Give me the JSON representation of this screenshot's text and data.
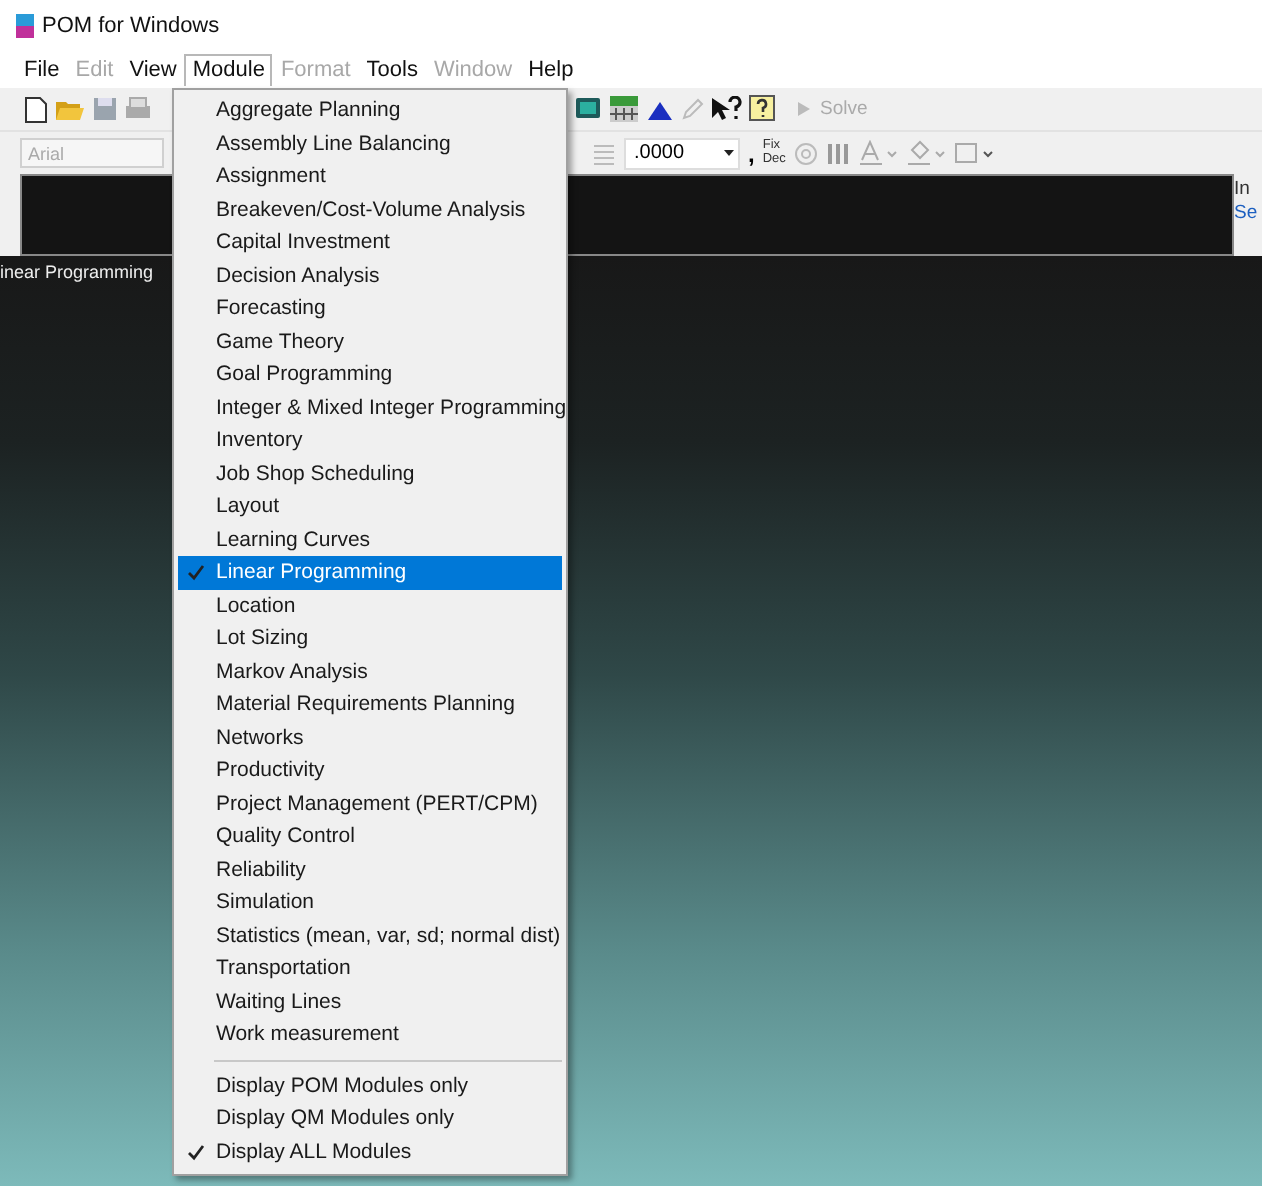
{
  "window": {
    "title": "POM for Windows"
  },
  "menu_bar": [
    {
      "label": "File",
      "disabled": false,
      "selected": false
    },
    {
      "label": "Edit",
      "disabled": true,
      "selected": false
    },
    {
      "label": "View",
      "disabled": false,
      "selected": false
    },
    {
      "label": "Module",
      "disabled": false,
      "selected": true
    },
    {
      "label": "Format",
      "disabled": true,
      "selected": false
    },
    {
      "label": "Tools",
      "disabled": false,
      "selected": false
    },
    {
      "label": "Window",
      "disabled": true,
      "selected": false
    },
    {
      "label": "Help",
      "disabled": false,
      "selected": false
    }
  ],
  "toolbar": {
    "solve_label": "Solve",
    "solve_disabled": true,
    "font_name": "Arial",
    "decimals": ".0000",
    "comma": ",",
    "fix_dec": [
      "Fix",
      "Dec"
    ]
  },
  "side_panel": {
    "line_1": "In",
    "line_2": "Se"
  },
  "document_title": "inear Programming",
  "module_menu": [
    {
      "label": "Aggregate Planning",
      "checked": false,
      "selected": false
    },
    {
      "label": "Assembly Line Balancing",
      "checked": false,
      "selected": false
    },
    {
      "label": "Assignment",
      "checked": false,
      "selected": false
    },
    {
      "label": "Breakeven/Cost-Volume Analysis",
      "checked": false,
      "selected": false
    },
    {
      "label": "Capital Investment",
      "checked": false,
      "selected": false
    },
    {
      "label": "Decision Analysis",
      "checked": false,
      "selected": false
    },
    {
      "label": "Forecasting",
      "checked": false,
      "selected": false
    },
    {
      "label": "Game Theory",
      "checked": false,
      "selected": false
    },
    {
      "label": "Goal Programming",
      "checked": false,
      "selected": false
    },
    {
      "label": "Integer & Mixed Integer Programming",
      "checked": false,
      "selected": false
    },
    {
      "label": "Inventory",
      "checked": false,
      "selected": false
    },
    {
      "label": "Job Shop Scheduling",
      "checked": false,
      "selected": false
    },
    {
      "label": "Layout",
      "checked": false,
      "selected": false
    },
    {
      "label": "Learning Curves",
      "checked": false,
      "selected": false
    },
    {
      "label": "Linear Programming",
      "checked": true,
      "selected": true
    },
    {
      "label": "Location",
      "checked": false,
      "selected": false
    },
    {
      "label": "Lot Sizing",
      "checked": false,
      "selected": false
    },
    {
      "label": "Markov Analysis",
      "checked": false,
      "selected": false
    },
    {
      "label": "Material Requirements Planning",
      "checked": false,
      "selected": false
    },
    {
      "label": "Networks",
      "checked": false,
      "selected": false
    },
    {
      "label": "Productivity",
      "checked": false,
      "selected": false
    },
    {
      "label": "Project Management (PERT/CPM)",
      "checked": false,
      "selected": false
    },
    {
      "label": "Quality Control",
      "checked": false,
      "selected": false
    },
    {
      "label": "Reliability",
      "checked": false,
      "selected": false
    },
    {
      "label": "Simulation",
      "checked": false,
      "selected": false
    },
    {
      "label": "Statistics (mean, var, sd; normal dist)",
      "checked": false,
      "selected": false
    },
    {
      "label": "Transportation",
      "checked": false,
      "selected": false
    },
    {
      "label": "Waiting Lines",
      "checked": false,
      "selected": false
    },
    {
      "label": "Work measurement",
      "checked": false,
      "selected": false
    }
  ],
  "display_options": [
    {
      "label": "Display POM Modules only",
      "checked": false,
      "selected": false
    },
    {
      "label": "Display QM Modules only",
      "checked": false,
      "selected": false
    },
    {
      "label": "Display ALL Modules",
      "checked": true,
      "selected": false
    }
  ]
}
